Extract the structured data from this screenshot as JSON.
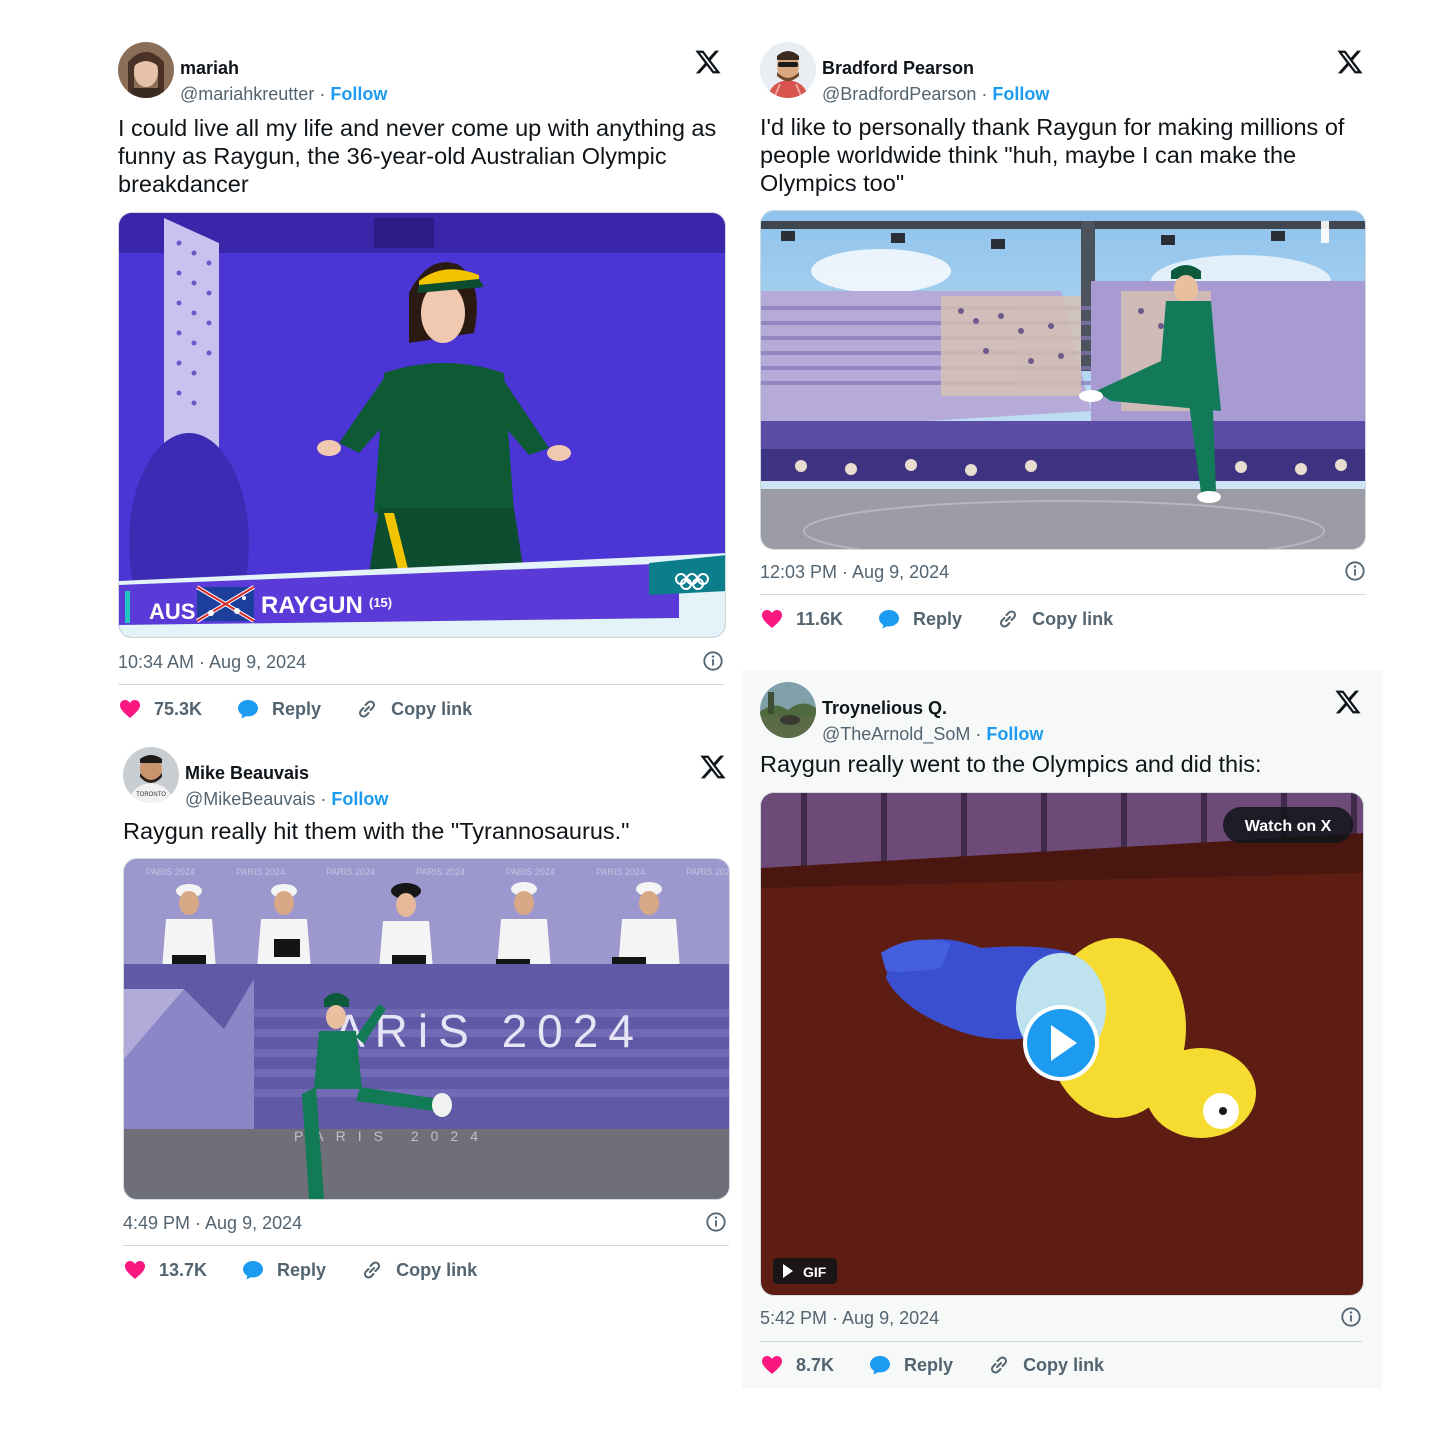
{
  "tweets": [
    {
      "name": "mariah",
      "handle": "@mariahkreutter",
      "separator": "·",
      "follow": "Follow",
      "text": "I could live all my life and never come up with anything as funny as Raygun, the 36-year-old Australian Olympic breakdancer",
      "media": {
        "country": "AUS",
        "athlete": "RAYGUN",
        "number": "(15)"
      },
      "timestamp": "10:34 AM · Aug 9, 2024",
      "likes": "75.3K",
      "reply": "Reply",
      "copy_link": "Copy link"
    },
    {
      "name": "Bradford Pearson",
      "handle": "@BradfordPearson",
      "separator": "·",
      "follow": "Follow",
      "text": "I'd like to personally thank Raygun for making millions of people worldwide think \"huh, maybe I can make the Olympics too\"",
      "timestamp": "12:03 PM · Aug 9, 2024",
      "likes": "11.6K",
      "reply": "Reply",
      "copy_link": "Copy link"
    },
    {
      "name": "Mike Beauvais",
      "handle": "@MikeBeauvais",
      "separator": "·",
      "follow": "Follow",
      "text": "Raygun really hit them with the \"Tyrannosaurus.\"",
      "media": {
        "banner": "PARIS 2024",
        "big": "ARiS 2024",
        "floor": "PARIS 2024"
      },
      "timestamp": "4:49 PM · Aug 9, 2024",
      "likes": "13.7K",
      "reply": "Reply",
      "copy_link": "Copy link"
    },
    {
      "name": "Troynelious Q.",
      "handle": "@TheArnold_SoM",
      "separator": "·",
      "follow": "Follow",
      "text": "Raygun really went to the Olympics and did this:",
      "media": {
        "watch": "Watch on X",
        "gif": "GIF"
      },
      "timestamp": "5:42 PM · Aug 9, 2024",
      "likes": "8.7K",
      "reply": "Reply",
      "copy_link": "Copy link"
    }
  ],
  "colors": {
    "like": "#f91880",
    "reply": "#1d9bf0",
    "follow": "#1d9bf0",
    "muted": "#536471"
  },
  "icons": [
    "x-logo-icon",
    "heart-icon",
    "reply-bubble-icon",
    "link-icon",
    "info-icon",
    "play-icon"
  ]
}
